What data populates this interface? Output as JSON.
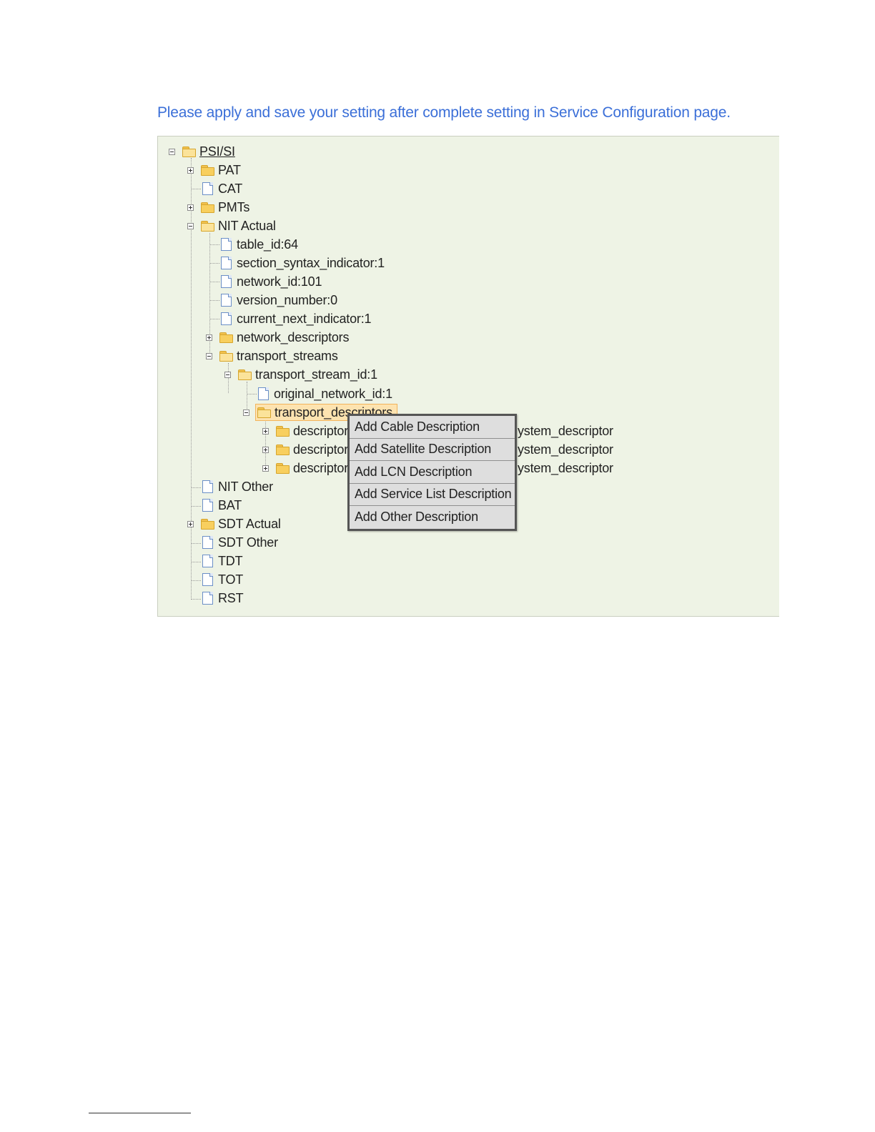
{
  "notice": "Please apply and save your setting after complete setting in Service Configuration page.",
  "tree": {
    "root": "PSI/SI",
    "pat": "PAT",
    "cat": "CAT",
    "pmts": "PMTs",
    "nit_actual": "NIT Actual",
    "nit_fields": [
      "table_id:64",
      "section_syntax_indicator:1",
      "network_id:101",
      "version_number:0",
      "current_next_indicator:1"
    ],
    "network_descriptors": "network_descriptors",
    "transport_streams": "transport_streams",
    "transport_stream_id": "transport_stream_id:1",
    "original_network_id": "original_network_id:1",
    "transport_descriptors": "transport_descriptors",
    "descriptor_prefix": "descriptor",
    "descriptor_suffix": "ystem_descriptor",
    "nit_other": "NIT Other",
    "bat": "BAT",
    "sdt_actual": "SDT Actual",
    "sdt_other": "SDT Other",
    "tdt": "TDT",
    "tot": "TOT",
    "rst": "RST"
  },
  "context_menu": [
    "Add Cable Description",
    "Add Satellite Description",
    "Add LCN Description",
    "Add Service List Description",
    "Add Other Description"
  ]
}
